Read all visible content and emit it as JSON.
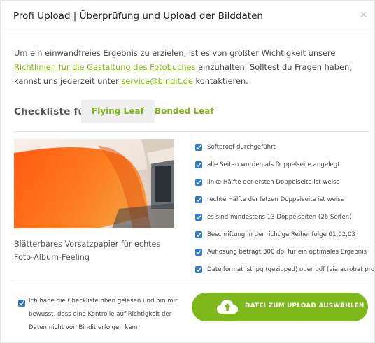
{
  "header": {
    "title": "Profi Upload | Überprüfung und Upload der Bilddaten",
    "close_label": "×"
  },
  "intro": {
    "text_1": "Um ein einwandfreies Ergebnis zu erzielen, ist es von größter Wichtigkeit unsere ",
    "link_guidelines": "Richtlinien für die Gestaltung des Fotobuches",
    "text_2": " einzuhalten. Solltest du Fragen haben, kannst uns jederzeit unter ",
    "link_email": "service@bindit.de",
    "text_3": " kontaktieren."
  },
  "checklist": {
    "label": "Checkliste für",
    "tabs": [
      {
        "label": "Flying Leaf",
        "active": true
      },
      {
        "label": "Bonded Leaf",
        "active": false
      }
    ],
    "caption": "Blätterbares Vorsatzpapier für echtes Foto-Album-Feeling",
    "items": [
      {
        "label": "Softproof durchgeführt",
        "checked": true
      },
      {
        "label": "alle Seiten wurden als Doppelseite angelegt",
        "checked": true
      },
      {
        "label": "linke Hälfte der ersten Doppelseite ist weiss",
        "checked": true
      },
      {
        "label": "rechte Hälfte der letzen Doppelseite ist weiss",
        "checked": true
      },
      {
        "label": "es sind mindestens 13 Doppelseiten (26 Seiten)",
        "checked": true
      },
      {
        "label": "Beschriftung in der richtige Reihenfolge 01,02,03",
        "checked": true
      },
      {
        "label": "Auflösung beträgt 300 dpi für ein optimales Ergebnis",
        "checked": true
      },
      {
        "label": "Dateiformat ist jpg (gezipped) oder pdf (via acrobat pro)",
        "checked": true
      }
    ]
  },
  "footer": {
    "confirm_text": "Ich habe die Checkliste oben gelesen und bin mir bewusst, dass eine Kontrolle auf Richtigkeit der Daten nicht von Bindit erfolgen kann",
    "confirm_checked": true,
    "upload_label": "DATEI ZUM UPLOAD AUSWÄHLEN",
    "upload_icon": "cloud-upload-icon"
  },
  "colors": {
    "accent_green": "#7fb81b",
    "checkbox_blue": "#2f7ad0"
  }
}
